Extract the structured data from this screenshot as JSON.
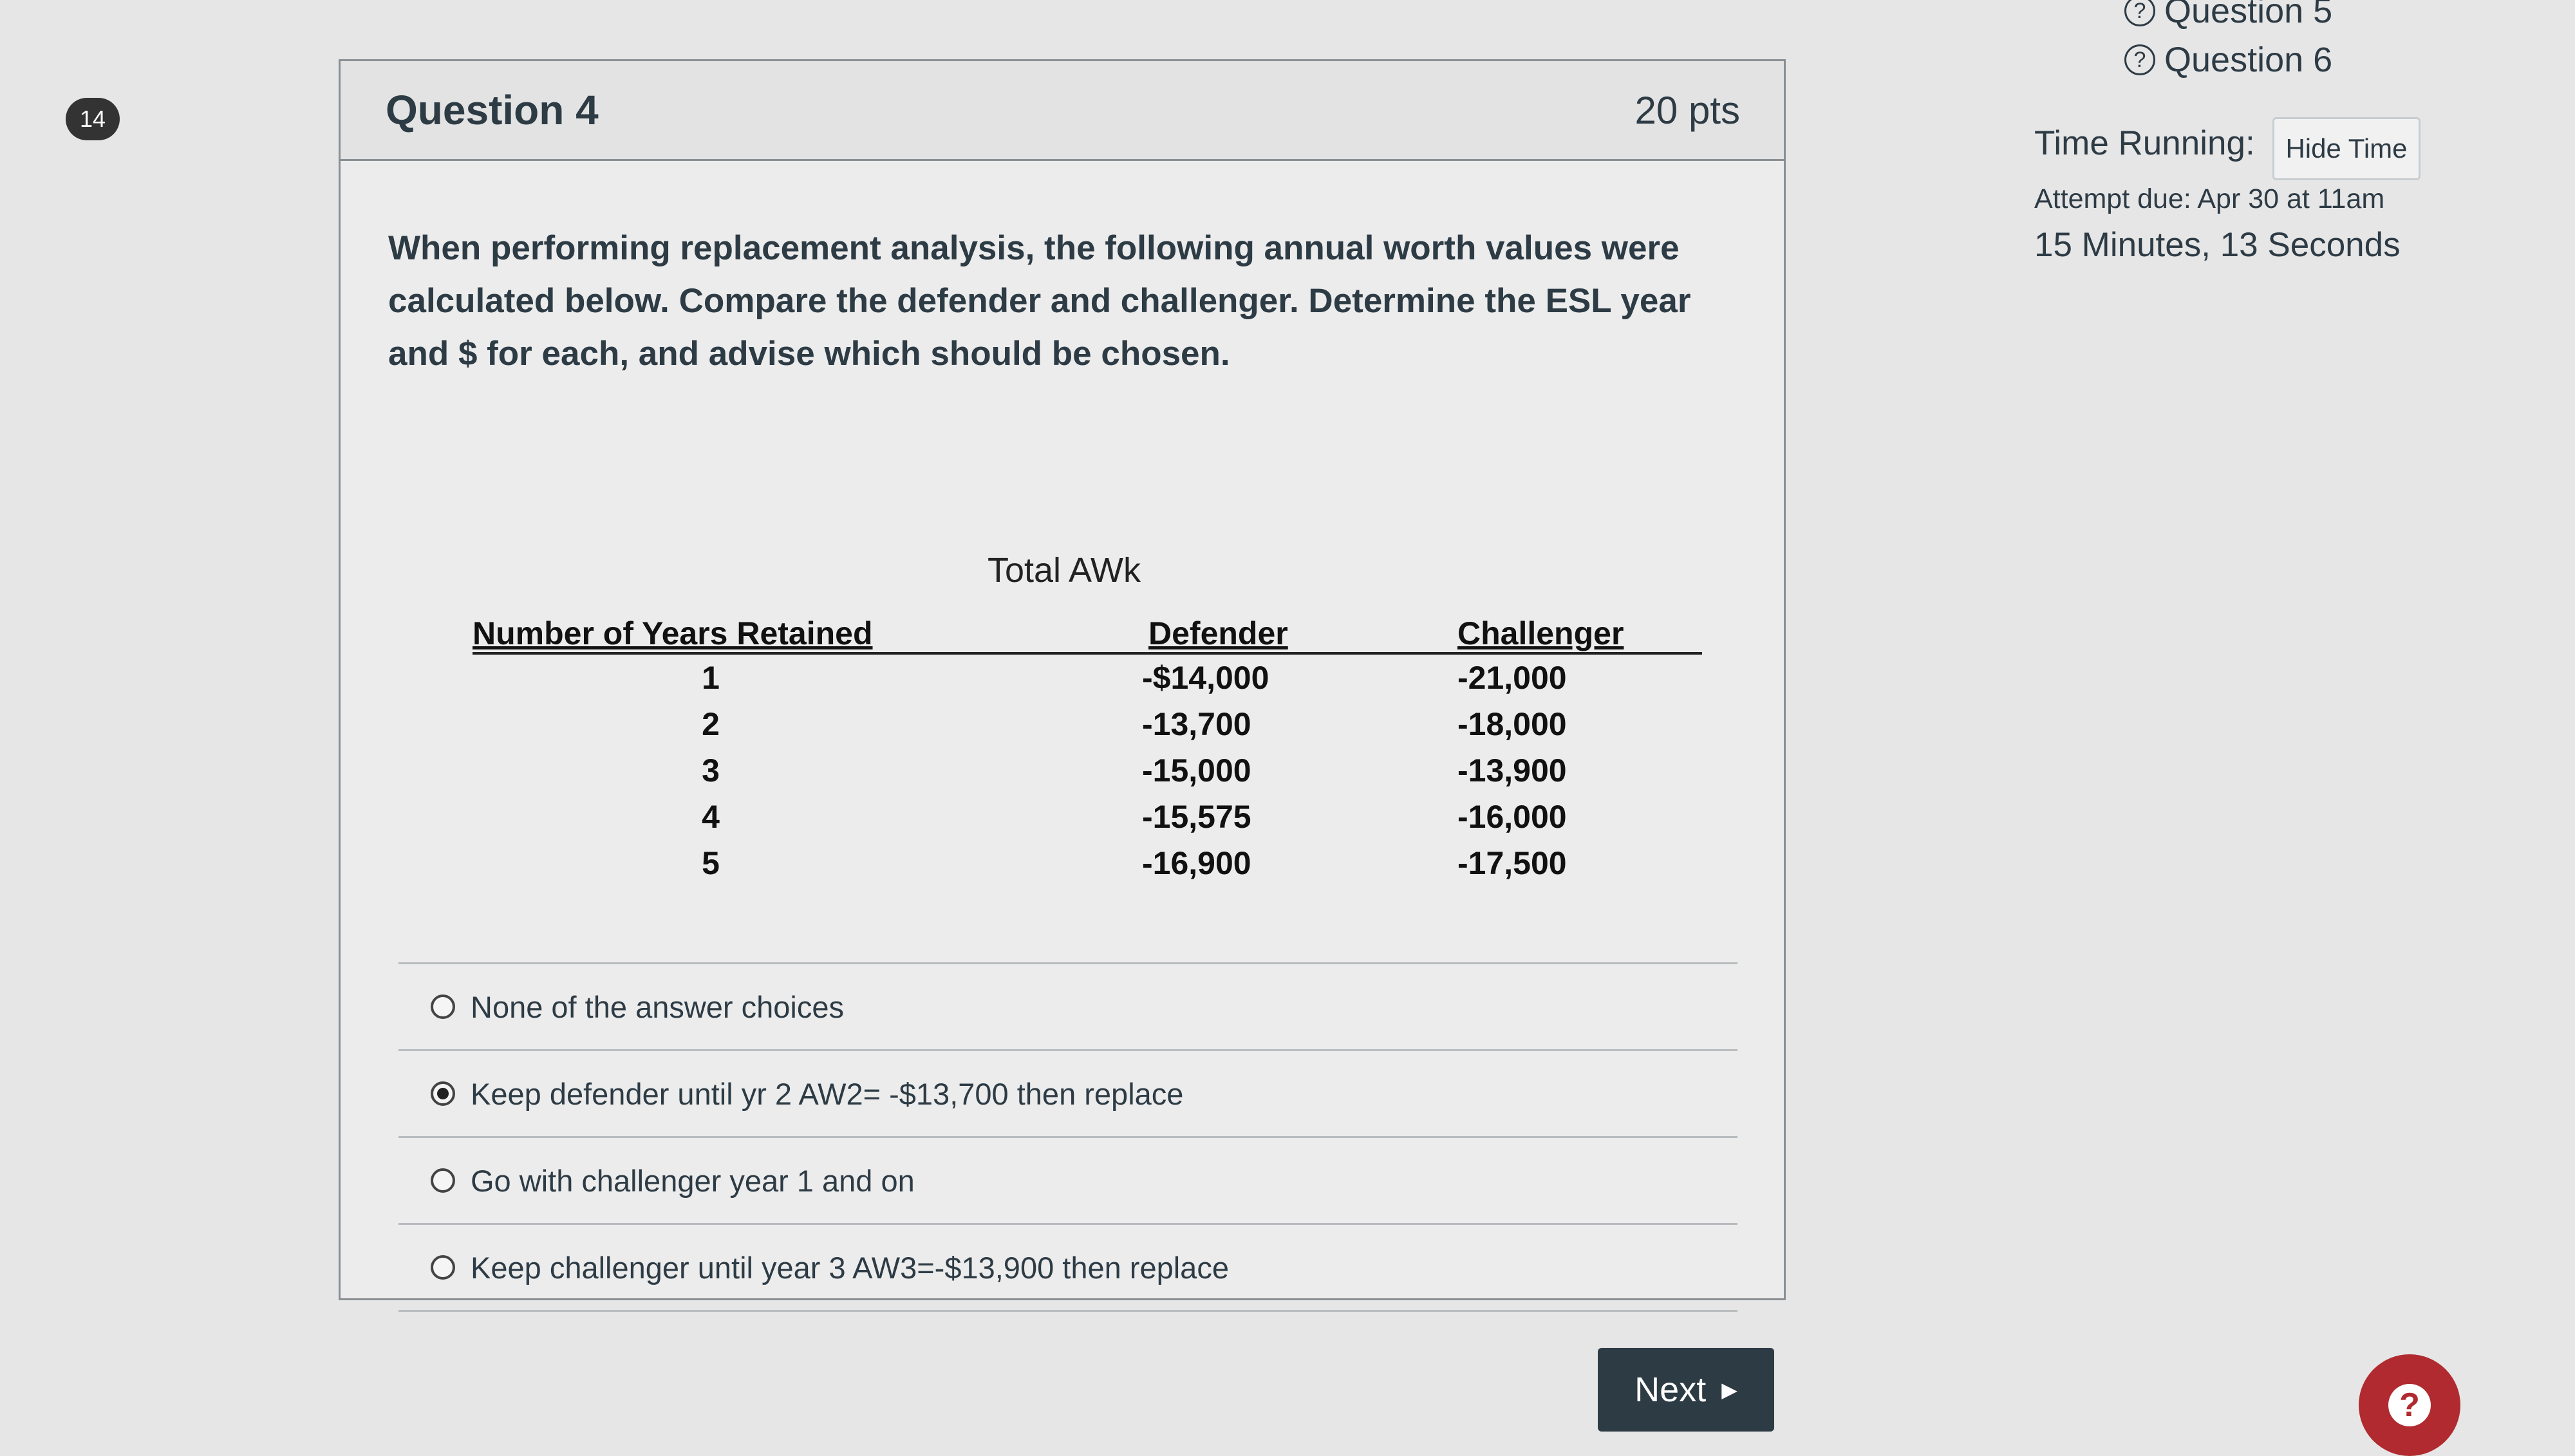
{
  "badge": "14",
  "question": {
    "title": "Question 4",
    "points": "20 pts",
    "text": "When performing replacement analysis, the following annual worth values were calculated below. Compare the defender and challenger. Determine the ESL year and $ for each, and advise which should be chosen.",
    "table": {
      "title": "Total AWk",
      "headers": [
        "Number of Years Retained",
        "Defender",
        "Challenger"
      ],
      "rows": [
        [
          "1",
          "-$14,000",
          "-21,000"
        ],
        [
          "2",
          "-13,700",
          "-18,000"
        ],
        [
          "3",
          "-15,000",
          "-13,900"
        ],
        [
          "4",
          "-15,575",
          "-16,000"
        ],
        [
          "5",
          "-16,900",
          "-17,500"
        ]
      ]
    },
    "answers": [
      {
        "label": "None of the answer choices",
        "selected": false
      },
      {
        "label": "Keep defender until yr 2 AW2= -$13,700 then replace",
        "selected": true
      },
      {
        "label": "Go with challenger year 1 and on",
        "selected": false
      },
      {
        "label": "Keep challenger until year 3 AW3=-$13,900 then replace",
        "selected": false
      }
    ]
  },
  "nav": {
    "next_label": "Next"
  },
  "sidebar": {
    "question_links": [
      "Question 5",
      "Question 6"
    ],
    "time_label": "Time Running:",
    "hide_time_label": "Hide Time",
    "attempt_due": "Attempt due: Apr 30 at 11am",
    "timer": "15 Minutes, 13 Seconds"
  },
  "help_label": "?"
}
